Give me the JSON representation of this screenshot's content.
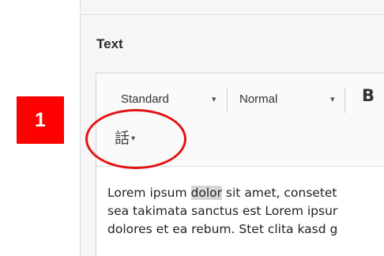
{
  "panel": {
    "field_label": "Text"
  },
  "toolbar": {
    "style_select_value": "Standard",
    "size_select_value": "Normal",
    "bold_label": "B",
    "language_button_glyph": "話",
    "caret": "▾"
  },
  "content": {
    "lines": [
      {
        "before": "Lorem ipsum ",
        "highlight": "dolor",
        "after": " sit amet, consetet"
      },
      {
        "text": "sea takimata sanctus est Lorem ipsur"
      },
      {
        "text": "dolores et ea rebum. Stet clita kasd g"
      }
    ]
  },
  "callout": {
    "step_number": "1",
    "ring_color": "#e31313",
    "badge_color": "#ff0000"
  }
}
